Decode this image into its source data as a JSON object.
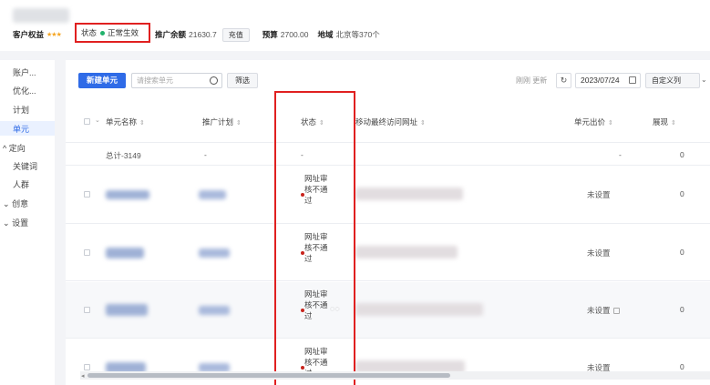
{
  "header": {
    "account_label": "客户权益",
    "status_label": "状态",
    "status_value": "正常生效",
    "spend_label": "推广余额",
    "spend_value": "21630.7",
    "recharge_button": "充值",
    "budget_label": "预算",
    "budget_value": "2700.00",
    "region_label": "地域",
    "region_value": "北京等370个"
  },
  "sidebar": {
    "items": [
      {
        "label": "账户..."
      },
      {
        "label": "优化..."
      },
      {
        "label": "计划"
      },
      {
        "label": "单元"
      },
      {
        "label": "定向"
      },
      {
        "label": "关键词"
      },
      {
        "label": "人群"
      },
      {
        "label": "创意"
      },
      {
        "label": "设置"
      }
    ],
    "expand_icon": "chevron-up-icon",
    "collapse_icon": "chevron-down-icon"
  },
  "toolbar": {
    "new_unit_button": "新建单元",
    "search_placeholder": "请搜索单元",
    "filter_button": "筛选",
    "refresh_text": "刚刚 更新",
    "date_value": "2023/07/24",
    "custom_columns_button": "自定义列"
  },
  "table": {
    "columns": [
      "单元名称",
      "推广计划",
      "状态",
      "移动最终访问网址",
      "单元出价",
      "展现"
    ],
    "total_row": {
      "name": "总计-3149",
      "plan": "-",
      "status": "-",
      "bid": "-",
      "impressions": "0"
    },
    "rows": [
      {
        "status": "网址审核不通过",
        "bid": "未设置",
        "impressions": "0"
      },
      {
        "status": "网址审核不通过",
        "bid": "未设置",
        "impressions": "0"
      },
      {
        "status": "网址审核不通过",
        "bid": "未设置",
        "impressions": "0"
      },
      {
        "status": "网址审核不通过",
        "bid": "未设置",
        "impressions": "0"
      }
    ]
  },
  "colors": {
    "primary": "#2f6be7",
    "highlight": "#e02020",
    "status_ok": "#21b26c",
    "status_error": "#c8241d"
  }
}
